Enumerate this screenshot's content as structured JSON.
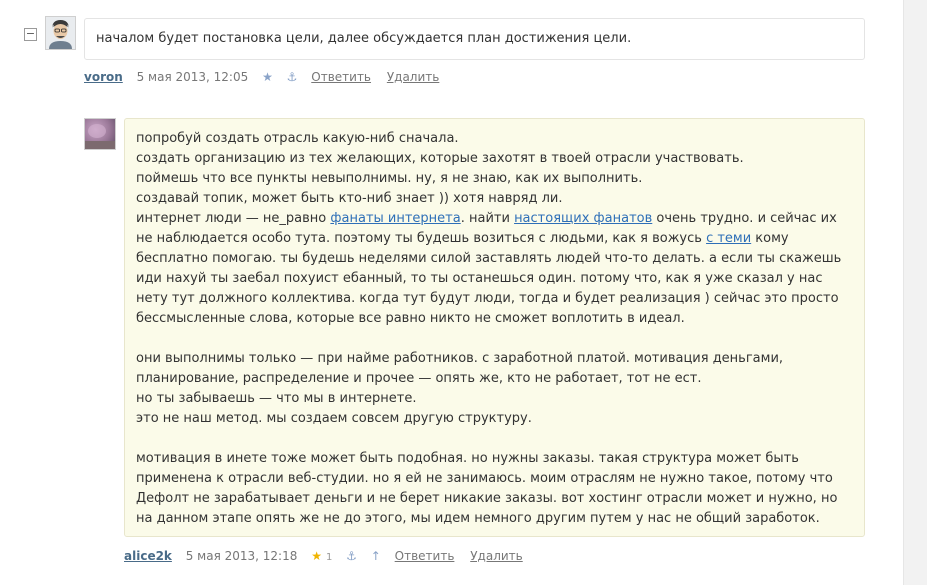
{
  "comment1": {
    "text": "началом будет постановка цели, далее обсуждается план достижения цели.",
    "author": "voron",
    "date": "5 мая 2013, 12:05",
    "star_icon": "star-icon",
    "anchor_icon": "anchor-icon",
    "reply_label": "Ответить",
    "delete_label": "Удалить",
    "collapse_label": "−"
  },
  "comment2": {
    "paragraphs": [
      [
        {
          "t": "попробуй создать отрасль какую-ниб сначала."
        },
        {
          "br": true
        },
        {
          "t": "создать организацию из тех желающих, которые захотят в твоей отрасли участвовать."
        },
        {
          "br": true
        },
        {
          "t": "поймешь что все пункты невыполнимы. ну, я не знаю, как их выполнить."
        },
        {
          "br": true
        },
        {
          "t": "создавай топик, может быть кто-ниб знает )) хотя навряд ли."
        },
        {
          "br": true
        },
        {
          "t": "интернет люди — не_равно "
        },
        {
          "link": "фанаты интернета"
        },
        {
          "t": ". найти "
        },
        {
          "link": "настоящих фанатов"
        },
        {
          "t": " очень трудно. и сейчас их не наблюдается особо тута. поэтому ты будешь возиться с людьми, как я вожусь "
        },
        {
          "link": "с теми"
        },
        {
          "t": " кому бесплатно помогаю. ты будешь неделями силой заставлять людей что-то делать. а если ты скажешь иди нахуй ты заебал похуист ебанный, то ты останешься один. потому что, как я уже сказал у нас нету тут должного коллектива. когда тут будут люди, тогда и будет реализация ) сейчас это просто бессмысленные слова, которые все равно никто не сможет воплотить в идеал."
        }
      ],
      [
        {
          "t": "они выполнимы только — при найме работников. с заработной платой. мотивация деньгами, планирование, распределение и прочее — опять же, кто не работает, тот не ест."
        },
        {
          "br": true
        },
        {
          "t": "но ты забываешь — что мы в интернете."
        },
        {
          "br": true
        },
        {
          "t": "это не наш метод. мы создаем совсем другую структуру."
        }
      ],
      [
        {
          "t": "мотивация в инете тоже может быть подобная. но нужны заказы. такая структура может быть применена к отрасли веб-студии. но я ей не занимаюсь. моим отраслям не нужно такое, потому что Дефолт не зарабатывает деньги и не берет никакие заказы. вот хостинг отрасли может и нужно, но на данном этапе опять же не до этого, мы идем немного другим путем у нас не общий заработок."
        }
      ]
    ],
    "author": "alice2k",
    "date": "5 мая 2013, 12:18",
    "star_icon": "star-filled-icon",
    "score": "1",
    "anchor_icon": "anchor-icon",
    "up_icon": "arrow-up-icon",
    "reply_label": "Ответить",
    "delete_label": "Удалить"
  },
  "colors": {
    "highlight_bg": "#fbfbe9",
    "link": "#2e6fb7",
    "author": "#496b88",
    "star_active": "#f0b400"
  }
}
